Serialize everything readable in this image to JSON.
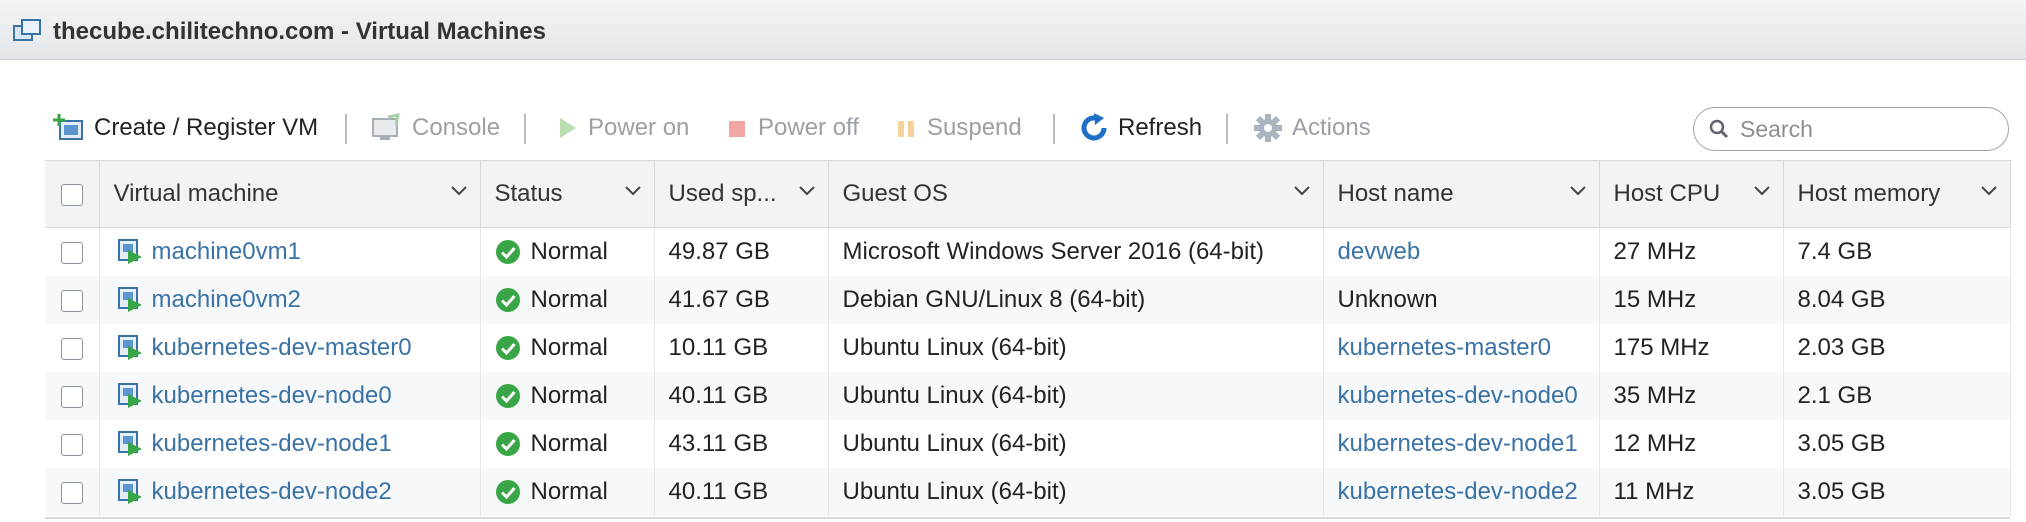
{
  "window": {
    "title": "thecube.chilitechno.com - Virtual Machines"
  },
  "toolbar": {
    "create": "Create / Register VM",
    "console": "Console",
    "power_on": "Power on",
    "power_off": "Power off",
    "suspend": "Suspend",
    "refresh": "Refresh",
    "actions": "Actions"
  },
  "search": {
    "placeholder": "Search",
    "value": ""
  },
  "table": {
    "columns": [
      "Virtual machine",
      "Status",
      "Used sp...",
      "Guest OS",
      "Host name",
      "Host CPU",
      "Host memory"
    ],
    "rows": [
      {
        "name": "machine0vm1",
        "status": "Normal",
        "used": "49.87 GB",
        "os": "Microsoft Windows Server 2016 (64-bit)",
        "host": "devweb",
        "host_link": true,
        "cpu": "27 MHz",
        "mem": "7.4 GB"
      },
      {
        "name": "machine0vm2",
        "status": "Normal",
        "used": "41.67 GB",
        "os": "Debian GNU/Linux 8 (64-bit)",
        "host": "Unknown",
        "host_link": false,
        "cpu": "15 MHz",
        "mem": "8.04 GB"
      },
      {
        "name": "kubernetes-dev-master0",
        "status": "Normal",
        "used": "10.11 GB",
        "os": "Ubuntu Linux (64-bit)",
        "host": "kubernetes-master0",
        "host_link": true,
        "cpu": "175 MHz",
        "mem": "2.03 GB"
      },
      {
        "name": "kubernetes-dev-node0",
        "status": "Normal",
        "used": "40.11 GB",
        "os": "Ubuntu Linux (64-bit)",
        "host": "kubernetes-dev-node0",
        "host_link": true,
        "cpu": "35 MHz",
        "mem": "2.1 GB"
      },
      {
        "name": "kubernetes-dev-node1",
        "status": "Normal",
        "used": "43.11 GB",
        "os": "Ubuntu Linux (64-bit)",
        "host": "kubernetes-dev-node1",
        "host_link": true,
        "cpu": "12 MHz",
        "mem": "3.05 GB"
      },
      {
        "name": "kubernetes-dev-node2",
        "status": "Normal",
        "used": "40.11 GB",
        "os": "Ubuntu Linux (64-bit)",
        "host": "kubernetes-dev-node2",
        "host_link": true,
        "cpu": "11 MHz",
        "mem": "3.05 GB"
      }
    ]
  },
  "colors": {
    "link": "#3a72a6",
    "status_ok": "#3aa547",
    "refresh": "#1e6fc7"
  }
}
